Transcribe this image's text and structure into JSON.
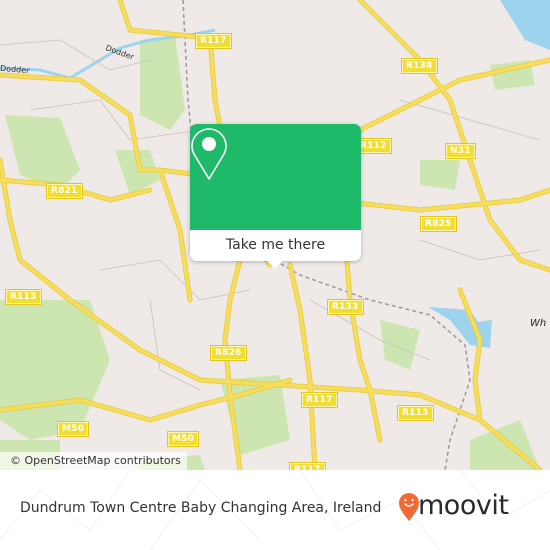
{
  "map": {
    "attribution": "© OpenStreetMap contributors",
    "road_shields": [
      {
        "label": "R117"
      },
      {
        "label": "R138"
      },
      {
        "label": "R821"
      },
      {
        "label": "R112"
      },
      {
        "label": "N31"
      },
      {
        "label": "R825"
      },
      {
        "label": "R113"
      },
      {
        "label": "R133"
      },
      {
        "label": "R826"
      },
      {
        "label": "R117"
      },
      {
        "label": "R113"
      },
      {
        "label": "M50"
      },
      {
        "label": "M50"
      },
      {
        "label": "R117"
      }
    ],
    "river_labels": [
      "Dodder",
      "Dodder"
    ],
    "place_labels": [
      "Wh"
    ],
    "colors": {
      "land": "#efeae7",
      "park": "#c8e6a7",
      "water": "#9ed3ee",
      "road": "#f6de5c",
      "road_border": "#e6c93a"
    }
  },
  "popup": {
    "button_label": "Take me there",
    "icon": "map-pin-icon",
    "color": "#1fb96a"
  },
  "footer": {
    "title": "Dundrum Town Centre Baby Changing Area, Ireland",
    "brand": "moovit",
    "brand_color": "#f26a35"
  }
}
